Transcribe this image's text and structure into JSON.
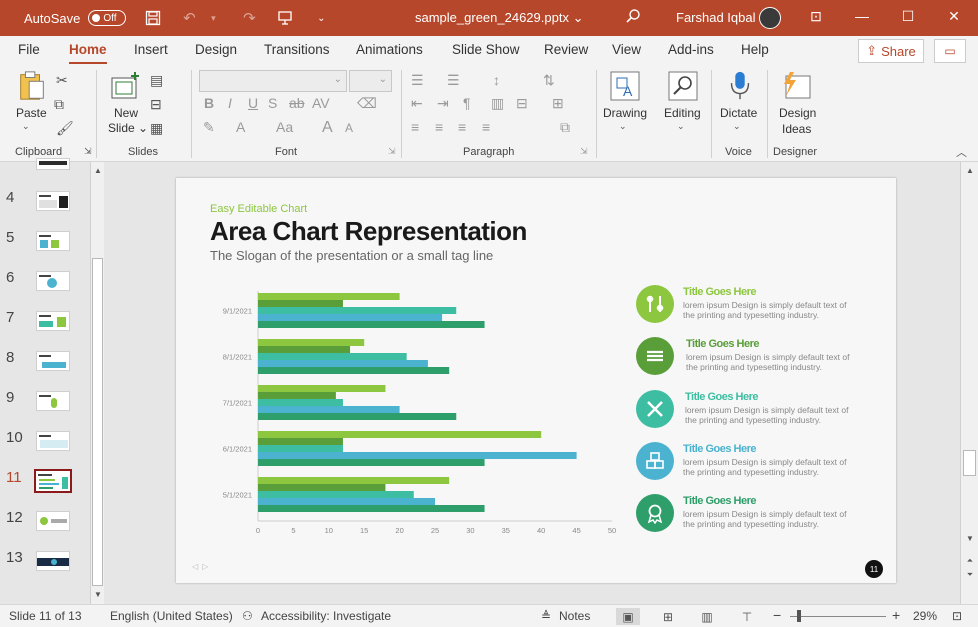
{
  "titlebar": {
    "autosave_label": "AutoSave",
    "autosave_state": "Off",
    "filename": "sample_green_24629.pptx",
    "filename_caret": "⌄",
    "user_name": "Farshad Iqbal"
  },
  "tabs": [
    "File",
    "Home",
    "Insert",
    "Design",
    "Transitions",
    "Animations",
    "Slide Show",
    "Review",
    "View",
    "Add-ins",
    "Help"
  ],
  "active_tab": "Home",
  "share_label": "Share",
  "ribbon": {
    "groups": {
      "clipboard": "Clipboard",
      "slides": "Slides",
      "font": "Font",
      "paragraph": "Paragraph",
      "voice": "Voice",
      "designer": "Designer"
    },
    "paste_label": "Paste",
    "new_slide_label_1": "New",
    "new_slide_label_2": "Slide",
    "drawing_label": "Drawing",
    "editing_label": "Editing",
    "dictate_label": "Dictate",
    "design_ideas_1": "Design",
    "design_ideas_2": "Ideas",
    "font_buttons": {
      "bold": "B",
      "italic": "I",
      "underline": "U",
      "shadow": "S",
      "strike": "ab",
      "spacing": "AV",
      "case": "Aa",
      "grow": "A",
      "shrink": "A"
    }
  },
  "thumbnails": {
    "numbers": [
      "4",
      "5",
      "6",
      "7",
      "8",
      "9",
      "10",
      "11",
      "12",
      "13"
    ],
    "active": "11"
  },
  "slide": {
    "kicker": "Easy Editable Chart",
    "title": "Area Chart Representation",
    "subtitle": "The Slogan of the presentation or a small tag line",
    "page_number": "11",
    "items": [
      {
        "title": "Title Goes Here",
        "body_1": "lorem ipsum Design is simply default text of",
        "body_2": "the printing and typesetting industry.",
        "color": "#8dc63f",
        "icon": "tools-icon"
      },
      {
        "title": "Title Goes Here",
        "body_1": "lorem ipsum Design is simply default text of",
        "body_2": "the printing and typesetting industry.",
        "color": "#5a9e3a",
        "icon": "stack-icon"
      },
      {
        "title": "Title Goes Here",
        "body_1": "lorem ipsum Design is simply default text of",
        "body_2": "the printing and typesetting industry.",
        "color": "#3dbea2",
        "icon": "ruler-pencil-icon"
      },
      {
        "title": "Title Goes Here",
        "body_1": "lorem ipsum Design is simply default text of",
        "body_2": "the printing and typesetting industry.",
        "color": "#4bb3cf",
        "icon": "cubes-icon"
      },
      {
        "title": "Title Goes Here",
        "body_1": "lorem ipsum Design is simply default text of",
        "body_2": "the printing and typesetting industry.",
        "color": "#2e9e6a",
        "icon": "award-icon"
      }
    ]
  },
  "chart_data": {
    "type": "bar",
    "orientation": "horizontal",
    "categories": [
      "9/1/2021",
      "8/1/2021",
      "7/1/2021",
      "6/1/2021",
      "5/1/2021"
    ],
    "series": [
      {
        "values": [
          20,
          15,
          18,
          40,
          27
        ],
        "color": "#8dc63f"
      },
      {
        "values": [
          12,
          13,
          11,
          12,
          18
        ],
        "color": "#5a9e3a"
      },
      {
        "values": [
          28,
          21,
          12,
          12,
          22
        ],
        "color": "#3dbea2"
      },
      {
        "values": [
          26,
          24,
          20,
          45,
          25
        ],
        "color": "#4bb3cf"
      },
      {
        "values": [
          32,
          27,
          28,
          32,
          32
        ],
        "color": "#2e9e6a"
      }
    ],
    "xlim": [
      0,
      50
    ],
    "xticks": [
      "0",
      "5",
      "10",
      "15",
      "20",
      "25",
      "30",
      "35",
      "40",
      "45",
      "50"
    ],
    "title": "",
    "xlabel": "",
    "ylabel": "",
    "grid": false,
    "legend": "none"
  },
  "statusbar": {
    "slide_info": "Slide 11 of 13",
    "language": "English (United States)",
    "accessibility": "Accessibility: Investigate",
    "notes": "Notes",
    "zoom": "29%"
  }
}
